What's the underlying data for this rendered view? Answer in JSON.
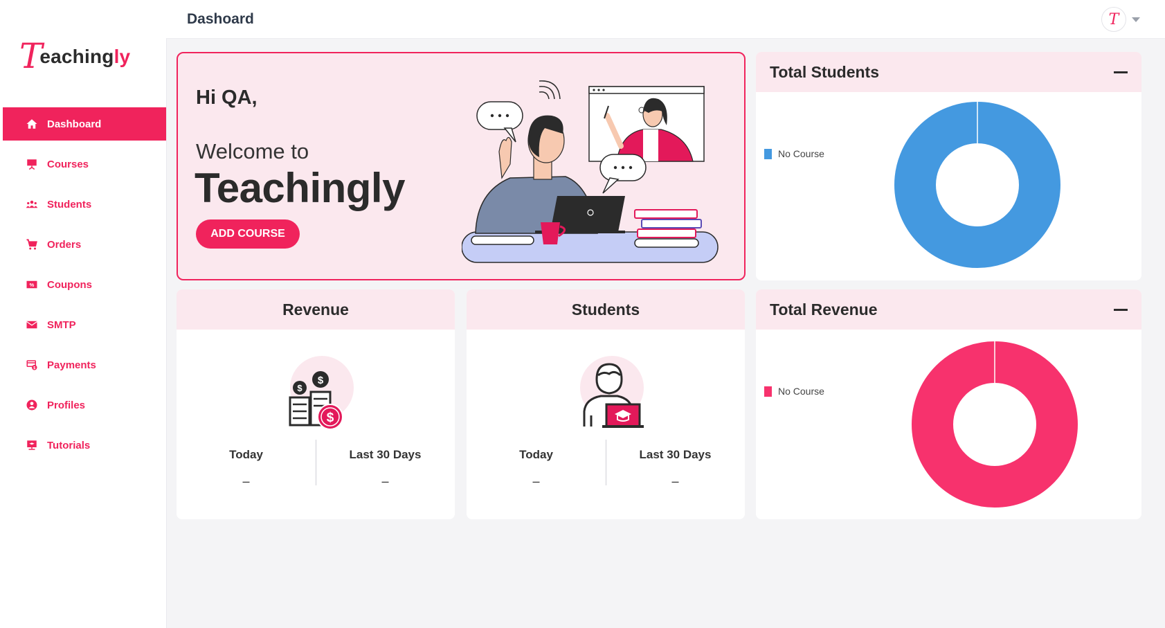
{
  "brand": {
    "logo_mark": "T",
    "logo_text_main": "eaching",
    "logo_text_accent": "ly"
  },
  "sidebar": {
    "items": [
      {
        "label": "Dashboard",
        "icon": "home-icon",
        "active": true
      },
      {
        "label": "Courses",
        "icon": "presentation-icon"
      },
      {
        "label": "Students",
        "icon": "users-icon"
      },
      {
        "label": "Orders",
        "icon": "cart-icon"
      },
      {
        "label": "Coupons",
        "icon": "coupon-icon"
      },
      {
        "label": "SMTP",
        "icon": "mail-icon"
      },
      {
        "label": "Payments",
        "icon": "payments-icon"
      },
      {
        "label": "Profiles",
        "icon": "user-circle-icon"
      },
      {
        "label": "Tutorials",
        "icon": "tutorial-icon"
      }
    ]
  },
  "header": {
    "title": "Dashoard",
    "avatar_mark": "T"
  },
  "welcome": {
    "greeting": "Hi QA,",
    "welcome_to": "Welcome to",
    "brand": "Teachingly",
    "button_label": "ADD COURSE"
  },
  "total_students": {
    "title": "Total Students",
    "chart_data": {
      "type": "pie",
      "donut": true,
      "categories": [
        "No Course"
      ],
      "values": [
        100
      ],
      "colors": [
        "#4499e0"
      ],
      "legend": "left"
    }
  },
  "total_revenue": {
    "title": "Total Revenue",
    "chart_data": {
      "type": "pie",
      "donut": true,
      "categories": [
        "No Course"
      ],
      "values": [
        100
      ],
      "colors": [
        "#f7326d"
      ],
      "legend": "left"
    }
  },
  "revenue": {
    "title": "Revenue",
    "today_label": "Today",
    "last30_label": "Last 30 Days",
    "today_value": "–",
    "last30_value": "–"
  },
  "students": {
    "title": "Students",
    "today_label": "Today",
    "last30_label": "Last 30 Days",
    "today_value": "–",
    "last30_value": "–"
  },
  "colors": {
    "accent": "#f0235c",
    "panel_header": "#fbe8ee",
    "students_chart": "#4499e0",
    "revenue_chart": "#f7326d"
  }
}
